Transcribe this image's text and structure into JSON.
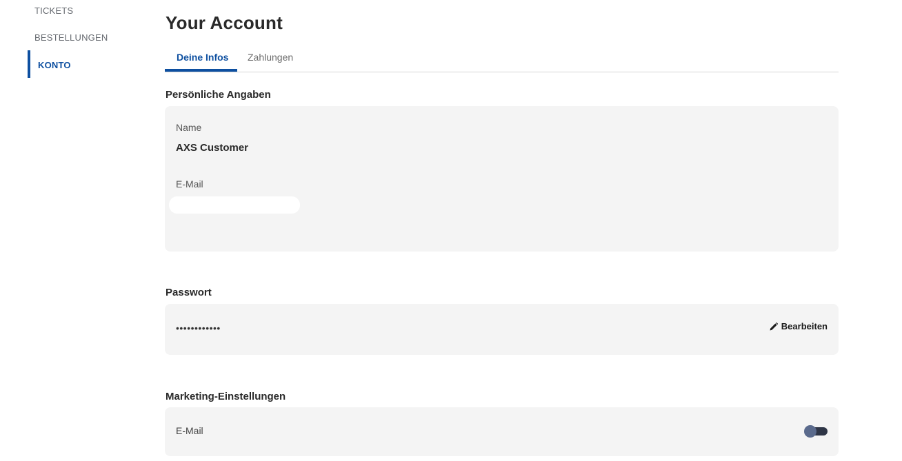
{
  "sidebar": {
    "items": [
      {
        "label": "TICKETS"
      },
      {
        "label": "BESTELLUNGEN"
      },
      {
        "label": "KONTO",
        "active": true
      }
    ]
  },
  "page": {
    "title": "Your Account"
  },
  "tabs": [
    {
      "label": "Deine Infos",
      "active": true
    },
    {
      "label": "Zahlungen",
      "active": false
    }
  ],
  "personal": {
    "section_title": "Persönliche Angaben",
    "name_label": "Name",
    "name_value": "AXS Customer",
    "email_label": "E-Mail"
  },
  "password": {
    "section_title": "Passwort",
    "masked_value": "••••••••••••",
    "edit_label": "Bearbeiten",
    "edit_icon": "pencil-icon"
  },
  "marketing": {
    "section_title": "Marketing-Einstellungen",
    "email_label": "E-Mail",
    "email_toggle_icon": "toggle-switch"
  },
  "colors": {
    "accent": "#0d4fa0",
    "card_background": "#f4f4f4",
    "toggle_track": "#2e3546",
    "toggle_knob": "#5a6a8c"
  }
}
